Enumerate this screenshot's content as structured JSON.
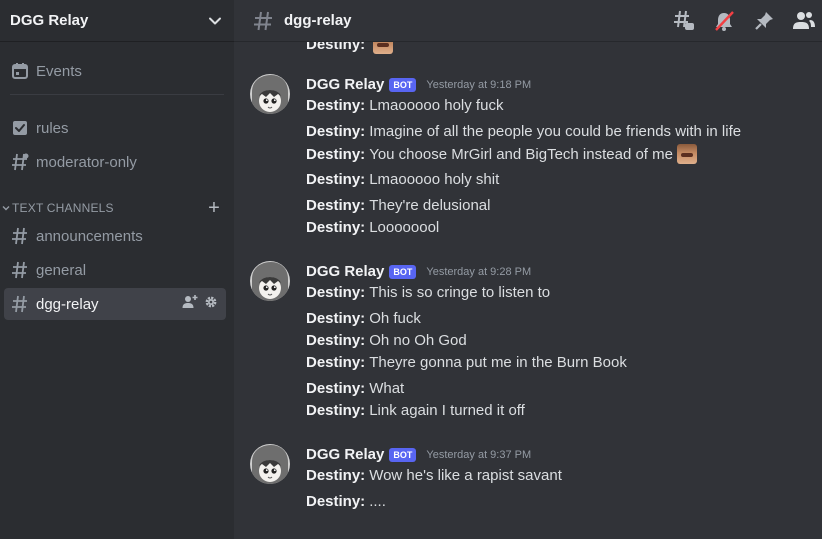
{
  "server": {
    "name": "DGG Relay"
  },
  "sidebar": {
    "top_items": [
      {
        "label": "Events",
        "icon": "calendar-icon"
      },
      {
        "label": "rules",
        "icon": "checkbox-icon"
      },
      {
        "label": "moderator-only",
        "icon": "hash-icon"
      }
    ],
    "category": "TEXT CHANNELS",
    "channels": [
      {
        "label": "announcements",
        "icon": "hash-icon"
      },
      {
        "label": "general",
        "icon": "hash-icon"
      },
      {
        "label": "dgg-relay",
        "icon": "hash-icon",
        "active": true
      }
    ]
  },
  "channel_header": {
    "name": "dgg-relay"
  },
  "colors": {
    "accent": "#5865f2",
    "background": "#313338",
    "sidebar": "#2b2d31"
  },
  "messages": {
    "partial_top": {
      "author": "Destiny:",
      "text": ""
    },
    "groups": [
      {
        "username": "DGG Relay",
        "badge": "BOT",
        "timestamp": "Yesterday at 9:18 PM",
        "lines": [
          {
            "author": "Destiny:",
            "text": "Lmaooooo holy fuck"
          },
          {
            "author": "Destiny:",
            "text": "Imagine of all the people you could be friends with in life"
          },
          {
            "author": "Destiny:",
            "text": "You choose MrGirl and BigTech instead of me"
          },
          {
            "author": "Destiny:",
            "text": "Lmaooooo holy shit"
          },
          {
            "author": "Destiny:",
            "text": "They're delusional"
          },
          {
            "author": "Destiny:",
            "text": "Loooooool"
          }
        ]
      },
      {
        "username": "DGG Relay",
        "badge": "BOT",
        "timestamp": "Yesterday at 9:28 PM",
        "lines": [
          {
            "author": "Destiny:",
            "text": "This is so cringe to listen to"
          },
          {
            "author": "Destiny:",
            "text": "Oh fuck"
          },
          {
            "author": "Destiny:",
            "text": "Oh no Oh God"
          },
          {
            "author": "Destiny:",
            "text": "Theyre gonna put me in the Burn Book"
          },
          {
            "author": "Destiny:",
            "text": "What"
          },
          {
            "author": "Destiny:",
            "text": "Link again I turned it off"
          }
        ]
      },
      {
        "username": "DGG Relay",
        "badge": "BOT",
        "timestamp": "Yesterday at 9:37 PM",
        "lines": [
          {
            "author": "Destiny:",
            "text": "Wow he's like a rapist savant"
          },
          {
            "author": "Destiny:",
            "text": "...."
          }
        ]
      }
    ]
  }
}
